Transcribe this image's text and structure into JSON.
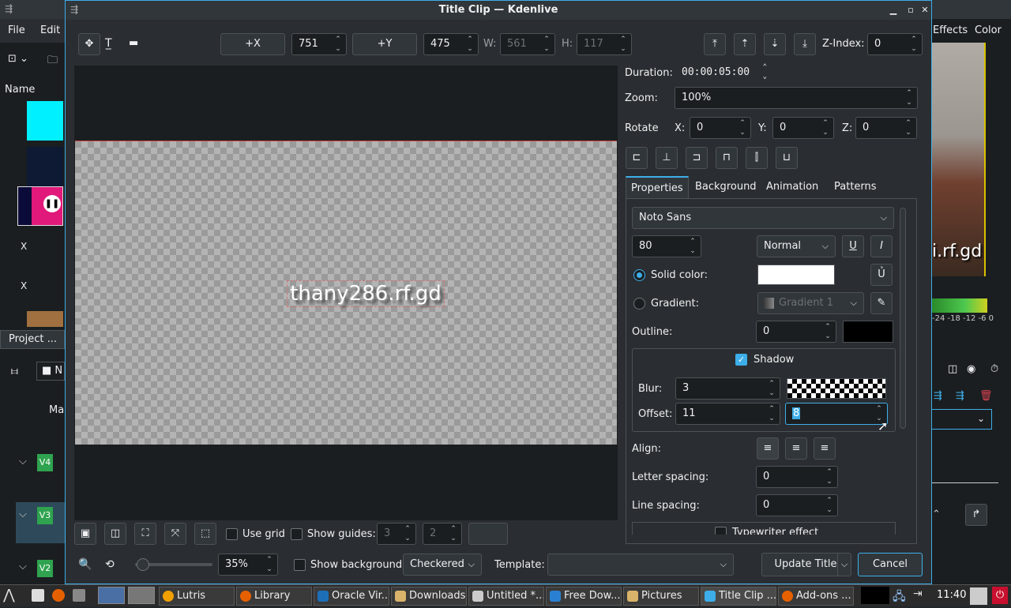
{
  "dialog": {
    "title": "Title Clip — Kdenlive",
    "toolbar": {
      "x_button": "+X",
      "x_value": "751",
      "y_button": "+Y",
      "y_value": "475",
      "w_label": "W:",
      "w_value": "561",
      "h_label": "H:",
      "h_value": "117",
      "zindex_label": "Z-Index:",
      "zindex_value": "0"
    },
    "canvas": {
      "text": "thany286.rf.gd"
    },
    "duration": {
      "label": "Duration:",
      "value": "00:00:05:00"
    },
    "zoom": {
      "label": "Zoom:",
      "value": "100%"
    },
    "rotate": {
      "label": "Rotate",
      "x_label": "X:",
      "x_value": "0",
      "y_label": "Y:",
      "y_value": "0",
      "z_label": "Z:",
      "z_value": "0"
    },
    "tabs": [
      "Properties",
      "Background",
      "Animation",
      "Patterns"
    ],
    "properties": {
      "font": "Noto Sans",
      "size": "80",
      "weight": "Normal",
      "solid_color_label": "Solid color:",
      "gradient_label": "Gradient:",
      "gradient_value": "Gradient 1",
      "outline_label": "Outline:",
      "outline_value": "0",
      "shadow_label": "Shadow",
      "blur_label": "Blur:",
      "blur_value": "3",
      "offset_label": "Offset:",
      "offset_x": "11",
      "offset_y": "8",
      "align_label": "Align:",
      "letter_spacing_label": "Letter spacing:",
      "letter_spacing_value": "0",
      "line_spacing_label": "Line spacing:",
      "line_spacing_value": "0",
      "typewriter_label": "Typewriter effect"
    },
    "bottom": {
      "use_grid": "Use grid",
      "show_guides": "Show guides:",
      "guides_h": "3",
      "guides_v": "2",
      "zoom_value": "35%",
      "show_background": "Show background",
      "background_mode": "Checkered",
      "template_label": "Template:",
      "update_button": "Update Title",
      "cancel_button": "Cancel"
    }
  },
  "background_app": {
    "menu": [
      "File",
      "Edit"
    ],
    "name_header": "Name",
    "project_tab": "Project ...",
    "effects": "Effects",
    "color": "Color",
    "list_x1": "X",
    "list_x2": "X",
    "tracks": [
      "V4",
      "V3",
      "V2"
    ],
    "ma_label": "Ma",
    "no_label": "N",
    "monitor_text": "i.rf.gd",
    "meter_labels": "-24 -18 -12 -6 0"
  },
  "taskbar": {
    "tasks": [
      "Lutris",
      "Library",
      "Oracle Vir...",
      "Downloads",
      "Untitled *...",
      "Free Dow...",
      "Pictures",
      "Title Clip ...",
      "Add-ons ..."
    ],
    "clock": "11:40"
  }
}
